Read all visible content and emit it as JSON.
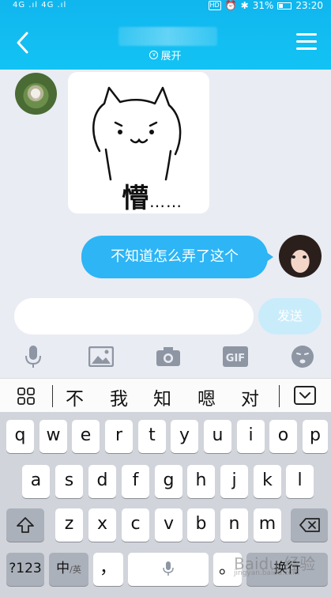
{
  "status": {
    "signal": "4G .ıl 4G .ıl",
    "hd": "HD",
    "battery": "31%",
    "time": "23:20"
  },
  "header": {
    "expand_label": "展开"
  },
  "chat": {
    "sticker_caption": "懵",
    "sticker_dots": "……",
    "message_right": "不知道怎么弄了这个"
  },
  "input": {
    "placeholder": "",
    "send_label": "发送"
  },
  "toolbar": {
    "icons": [
      "microphone-icon",
      "image-icon",
      "camera-icon",
      "gif-icon",
      "emoji-icon"
    ],
    "gif_label": "GIF"
  },
  "candidates": [
    "不",
    "我",
    "知",
    "嗯",
    "对"
  ],
  "keyboard": {
    "row1": [
      "q",
      "w",
      "e",
      "r",
      "t",
      "y",
      "u",
      "i",
      "o",
      "p"
    ],
    "row2": [
      "a",
      "s",
      "d",
      "f",
      "g",
      "h",
      "j",
      "k",
      "l"
    ],
    "row3": [
      "z",
      "x",
      "c",
      "v",
      "b",
      "n",
      "m"
    ],
    "num_label": "?123",
    "lang_label": "中",
    "lang_sub": "/英",
    "comma": "，",
    "period": "。",
    "enter_label": "换行"
  },
  "watermark": {
    "text": "Baidu 经验",
    "sub": "jingyan.baidu.com"
  },
  "colors": {
    "header": "#13c3f4",
    "bubble": "#2db5f5",
    "send_disabled": "#c9ecfb",
    "keyboard_bg": "#d1d4da"
  }
}
